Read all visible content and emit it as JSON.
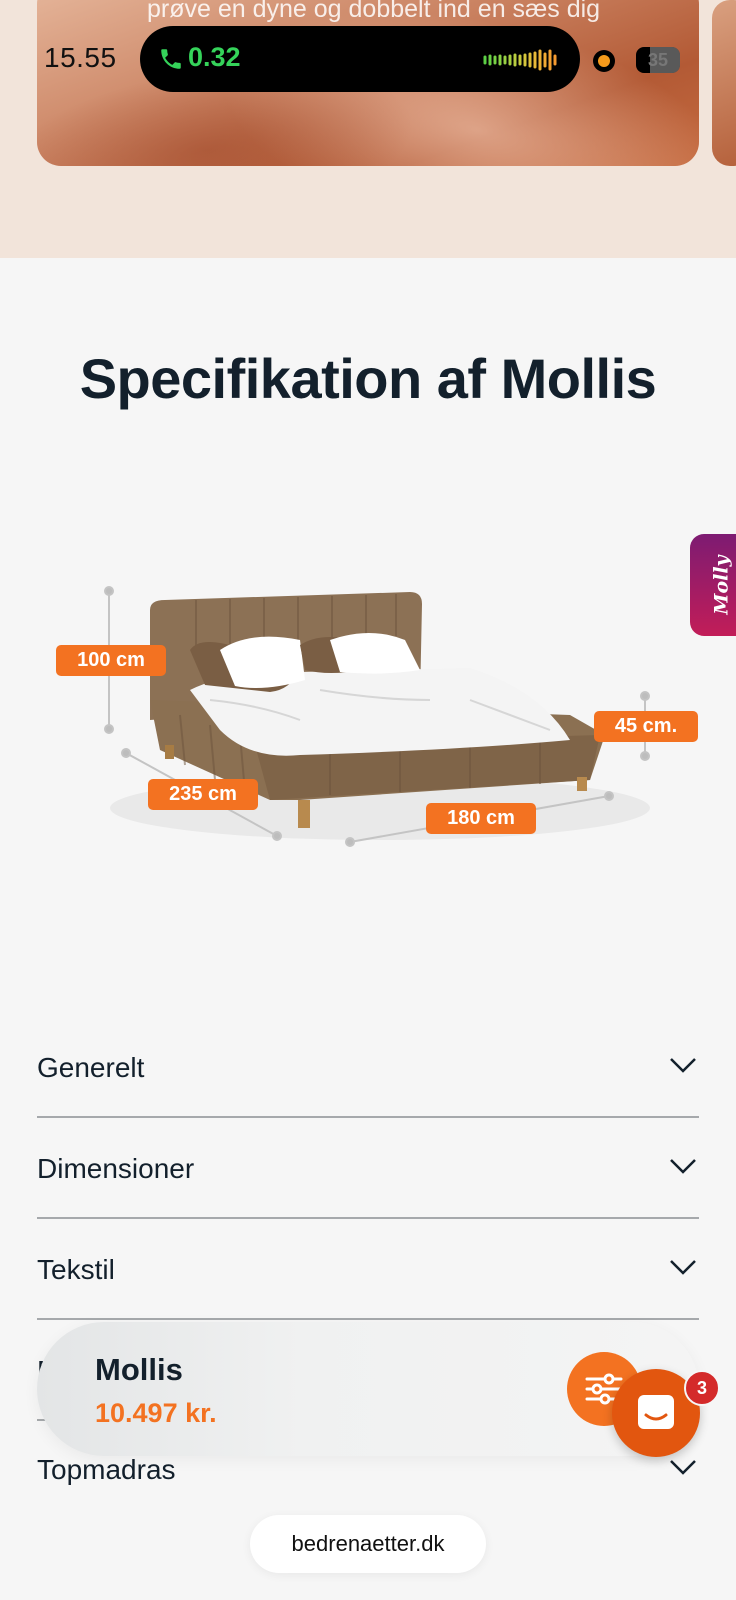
{
  "status_bar": {
    "time": "15.55",
    "call_duration": "0.32",
    "battery": "35"
  },
  "hero": {
    "text": "prøve en dyne og dobbelt ind en sæs dig"
  },
  "spec": {
    "title": "Specifikation af Mollis",
    "dimensions": {
      "height": "100 cm",
      "length": "235 cm",
      "width": "180 cm",
      "leg_height": "45 cm."
    }
  },
  "side_tab": {
    "label": "Molly"
  },
  "accordion": [
    {
      "label": "Generelt"
    },
    {
      "label": "Dimensioner"
    },
    {
      "label": "Tekstil"
    },
    {
      "label": "M"
    },
    {
      "label": "Topmadras"
    }
  ],
  "sticky": {
    "product_name": "Mollis",
    "price": "10.497 kr.",
    "chat_badge": "3"
  },
  "browser": {
    "url": "bedrenaetter.dk"
  },
  "colors": {
    "accent": "#f37221",
    "text": "#13202c",
    "background": "#f6f6f6"
  }
}
